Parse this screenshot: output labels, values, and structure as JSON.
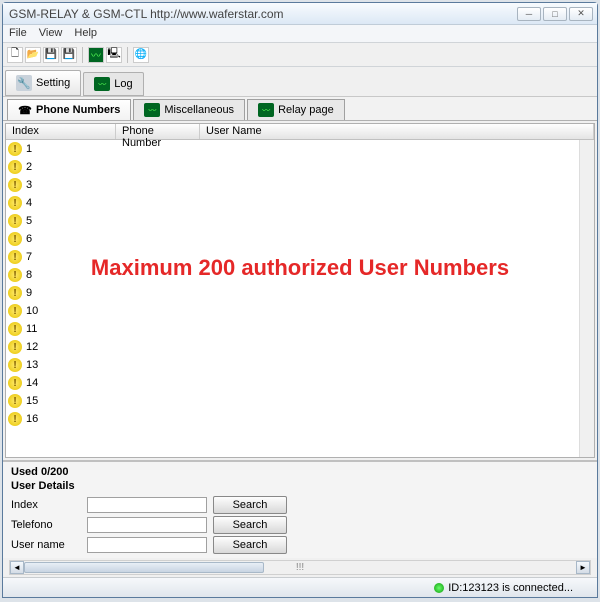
{
  "window": {
    "title": "GSM-RELAY & GSM-CTL    http://www.waferstar.com"
  },
  "menu": {
    "file": "File",
    "view": "View",
    "help": "Help"
  },
  "toolbar2": {
    "setting": "Setting",
    "log": "Log"
  },
  "subtabs": {
    "phone": "Phone Numbers",
    "misc": "Miscellaneous",
    "relay": "Relay page"
  },
  "columns": {
    "index": "Index",
    "phone": "Phone Number",
    "user": "User Name"
  },
  "rows": [
    "1",
    "2",
    "3",
    "4",
    "5",
    "6",
    "7",
    "8",
    "9",
    "10",
    "11",
    "12",
    "13",
    "14",
    "15",
    "16"
  ],
  "overlay": "Maximum 200 authorized User Numbers",
  "details": {
    "used": "Used 0/200",
    "heading": "User Details",
    "index_label": "Index",
    "telefono_label": "Telefono",
    "username_label": "User name",
    "search": "Search",
    "index_val": "",
    "tel_val": "",
    "un_val": ""
  },
  "hscroll_mark": "!!!",
  "status": {
    "text": "ID:123123 is connected..."
  }
}
